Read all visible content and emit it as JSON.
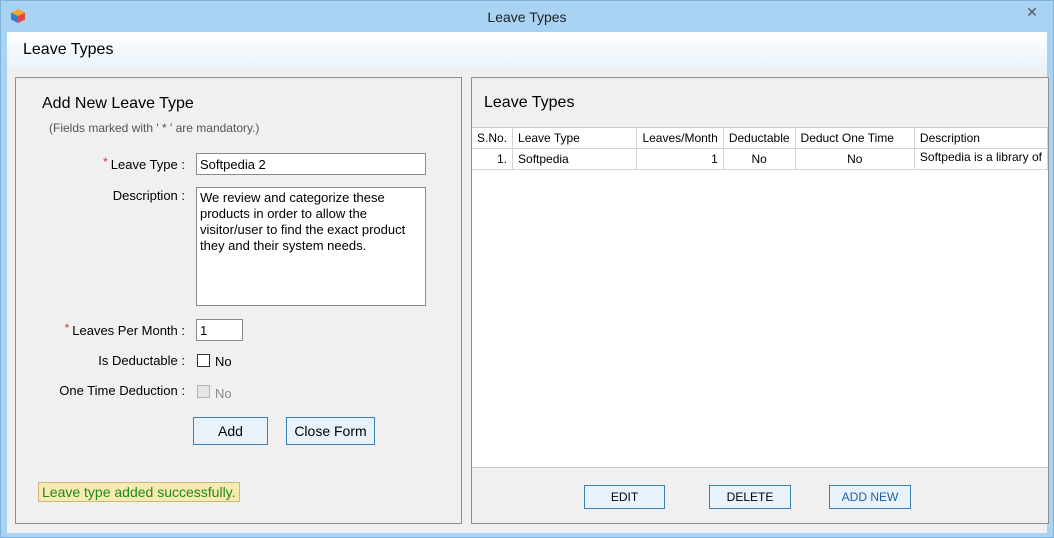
{
  "window": {
    "title": "Leave Types",
    "close_glyph": "✕"
  },
  "header": {
    "title": "Leave Types"
  },
  "form": {
    "title": "Add New Leave Type",
    "note": "(Fields marked with ' * ' are mandatory.)",
    "required_mark": "*",
    "leave_type_label": "Leave Type :",
    "leave_type_value": "Softpedia 2",
    "description_label": "Description :",
    "description_value": "We review and categorize these products in order to allow the visitor/user to find the exact product they and their system needs.",
    "leaves_per_month_label": "Leaves Per Month :",
    "leaves_per_month_value": "1",
    "is_deductable_label": "Is Deductable :",
    "is_deductable_option": "No",
    "one_time_deduction_label": "One Time Deduction :",
    "one_time_deduction_option": "No",
    "add_button": "Add",
    "close_button": "Close Form",
    "status_message": "Leave type added successfully."
  },
  "list": {
    "title": "Leave Types",
    "columns": [
      "S.No.",
      "Leave Type",
      "Leaves/Month",
      "Deductable",
      "Deduct One Time",
      "Description"
    ],
    "rows": [
      {
        "sno": "1.",
        "leave_type": "Softpedia",
        "leaves_month": "1",
        "deductable": "No",
        "deduct_one_time": "No",
        "description": "Softpedia is a library of"
      }
    ],
    "edit_button": "EDIT",
    "delete_button": "DELETE",
    "add_new_button": "ADD NEW"
  },
  "colors": {
    "frame": "#a9d3f2",
    "button_border": "#3c7fb1",
    "status_bg": "#f7eab1",
    "status_text": "#1e8a1e",
    "required_star": "#e03030"
  }
}
